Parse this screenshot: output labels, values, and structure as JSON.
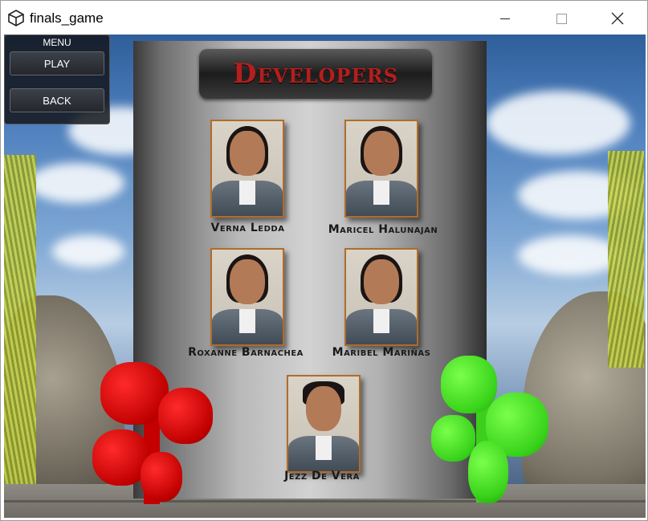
{
  "window": {
    "title": "finals_game",
    "icon": "unity-icon",
    "controls": {
      "minimize": "minimize-icon",
      "maximize": "maximize-icon",
      "close": "close-icon"
    }
  },
  "menu": {
    "title": "MENU",
    "buttons": [
      {
        "label": "PLAY"
      },
      {
        "label": "BACK"
      }
    ]
  },
  "banner": {
    "title": "Developers",
    "color": "#b41e1e"
  },
  "developers": [
    {
      "name": "Verna Ledda"
    },
    {
      "name": "Maricel Halunajan"
    },
    {
      "name": "Roxanne Barnachea"
    },
    {
      "name": "Maribel Mariñas"
    },
    {
      "name": "Jezz De Vera"
    }
  ],
  "colors": {
    "plant_left": "#d40000",
    "plant_right": "#46e01e",
    "photo_frame": "#b06c2a"
  }
}
